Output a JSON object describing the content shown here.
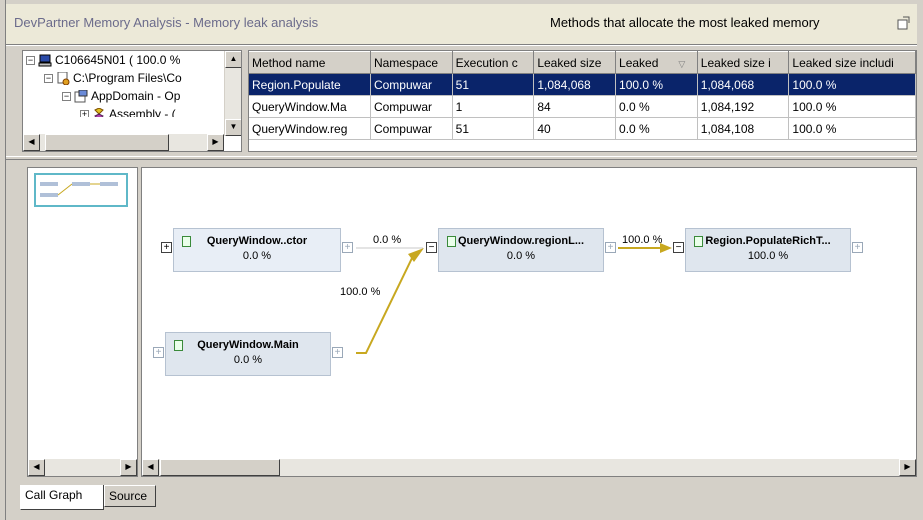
{
  "header": {
    "title": "DevPartner Memory Analysis - Memory leak analysis",
    "subtitle": "Methods that allocate the most leaked memory"
  },
  "tree": {
    "items": [
      {
        "label": "C106645N01 ( 100.0 %"
      },
      {
        "label": "C:\\Program Files\\Co"
      },
      {
        "label": "AppDomain - Op"
      },
      {
        "label": "Assembly - ("
      }
    ]
  },
  "table": {
    "headers": [
      "Method name",
      "Namespace",
      "Execution c",
      "Leaked size",
      "Leaked",
      "Leaked size i",
      "Leaked size includi"
    ],
    "rows": [
      [
        "Region.Populate",
        "Compuwar",
        "51",
        "1,084,068",
        "100.0 %",
        "1,084,068",
        "100.0 %"
      ],
      [
        "QueryWindow.Ma",
        "Compuwar",
        "1",
        "84",
        "0.0 %",
        "1,084,192",
        "100.0 %"
      ],
      [
        "QueryWindow.reg",
        "Compuwar",
        "51",
        "40",
        "0.0 %",
        "1,084,108",
        "100.0 %"
      ]
    ]
  },
  "graph": {
    "nodes": [
      {
        "name": "QueryWindow..ctor",
        "pct": "0.0 %"
      },
      {
        "name": "QueryWindow.Main",
        "pct": "0.0 %"
      },
      {
        "name": "QueryWindow.regionL...",
        "pct": "0.0 %"
      },
      {
        "name": "Region.PopulateRichT...",
        "pct": "100.0 %"
      }
    ],
    "edges": [
      {
        "label": "0.0 %"
      },
      {
        "label": "100.0 %"
      },
      {
        "label": "100.0 %"
      }
    ],
    "edge_color": "#c8a820"
  },
  "tabs": [
    "Call Graph",
    "Source"
  ]
}
